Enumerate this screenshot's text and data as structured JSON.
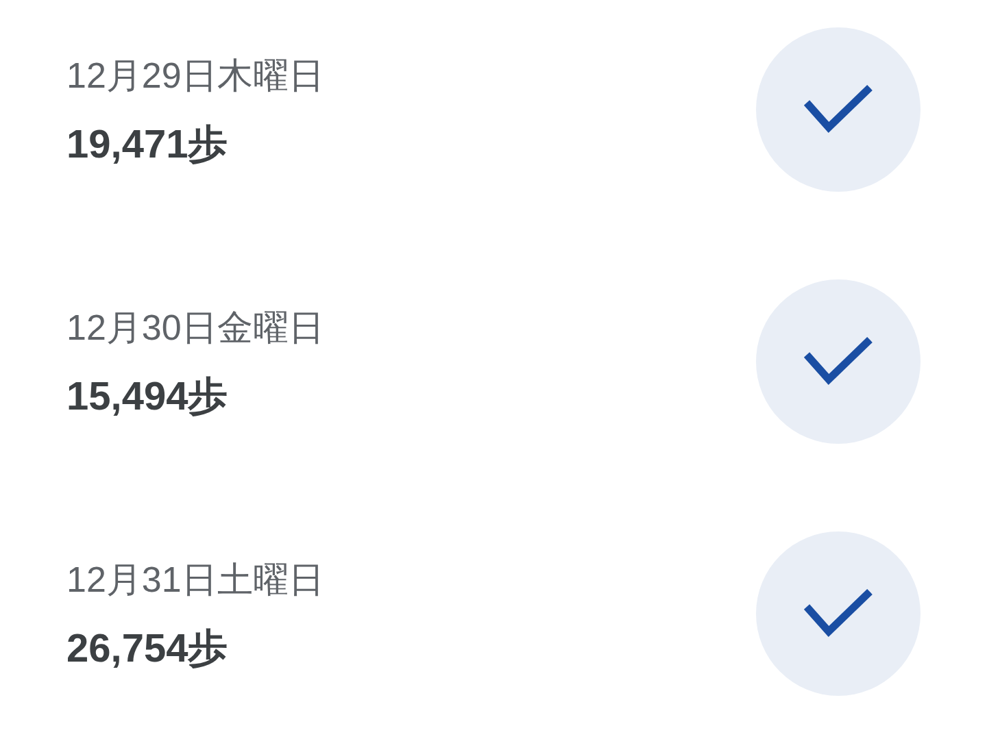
{
  "days": [
    {
      "date": "12月29日木曜日",
      "steps": "19,471歩",
      "goal_met": true
    },
    {
      "date": "12月30日金曜日",
      "steps": "15,494歩",
      "goal_met": true
    },
    {
      "date": "12月31日土曜日",
      "steps": "26,754歩",
      "goal_met": true
    }
  ]
}
